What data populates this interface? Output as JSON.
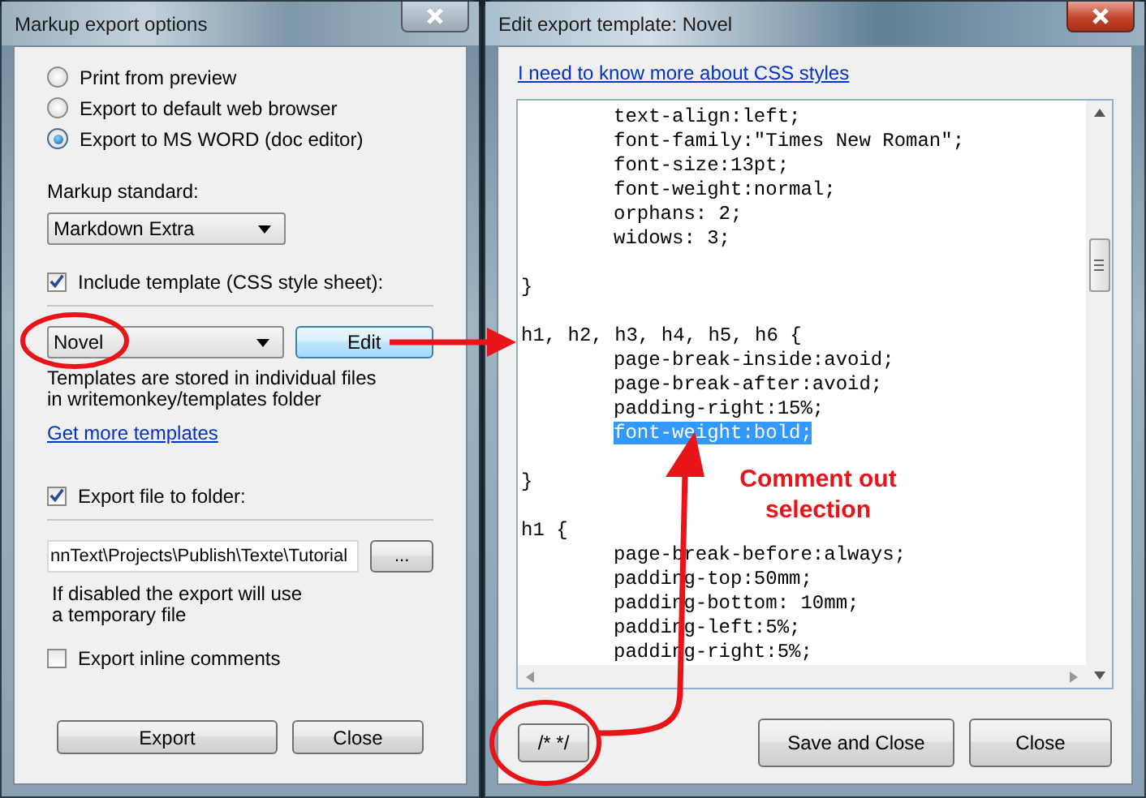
{
  "left_window": {
    "title": "Markup export options",
    "active": false,
    "output_options": [
      {
        "label": "Print from preview",
        "selected": false
      },
      {
        "label": "Export to default web browser",
        "selected": false
      },
      {
        "label": "Export to MS WORD (doc editor)",
        "selected": true
      }
    ],
    "markup_standard": {
      "label": "Markup standard:",
      "value": "Markdown Extra"
    },
    "include_template": {
      "label": "Include template (CSS style sheet):",
      "checked": true
    },
    "template": {
      "value": "Novel"
    },
    "edit_button": "Edit",
    "template_note": "Templates are stored in individual files\nin writemonkey/templates folder",
    "more_templates_link": "Get more templates",
    "export_to_folder": {
      "label": "Export file to folder:",
      "checked": true
    },
    "folder_path": "nnText\\Projects\\Publish\\Texte\\Tutorial",
    "browse_button": "...",
    "folder_note": "If disabled the export will use\na temporary file",
    "inline_comments": {
      "label": "Export inline comments",
      "checked": false
    },
    "buttons": [
      "Export",
      "Close"
    ]
  },
  "right_window": {
    "title": "Edit export template: Novel",
    "active": true,
    "css_link": "I need to know more about CSS styles",
    "code_lines": [
      {
        "kind": "indented",
        "text": "text-align:left;",
        "selected": false
      },
      {
        "kind": "indented",
        "text": "font-family:\"Times New Roman\";",
        "selected": false
      },
      {
        "kind": "indented",
        "text": "font-size:13pt;",
        "selected": false
      },
      {
        "kind": "indented",
        "text": "font-weight:normal;",
        "selected": false
      },
      {
        "kind": "indented",
        "text": "orphans: 2;",
        "selected": false
      },
      {
        "kind": "indented",
        "text": "widows: 3;",
        "selected": false
      },
      {
        "kind": "blank"
      },
      {
        "kind": "top",
        "text": "}",
        "selected": false
      },
      {
        "kind": "blank"
      },
      {
        "kind": "top",
        "text": "h1, h2, h3, h4, h5, h6 {",
        "selected": false
      },
      {
        "kind": "indented",
        "text": "page-break-inside:avoid;",
        "selected": false
      },
      {
        "kind": "indented",
        "text": "page-break-after:avoid;",
        "selected": false
      },
      {
        "kind": "indented",
        "text": "padding-right:15%;",
        "selected": false
      },
      {
        "kind": "indented",
        "text": "font-weight:bold;",
        "selected": true
      },
      {
        "kind": "blank"
      },
      {
        "kind": "top",
        "text": "}",
        "selected": false
      },
      {
        "kind": "blank"
      },
      {
        "kind": "top",
        "text": "h1 {",
        "selected": false
      },
      {
        "kind": "indented",
        "text": "page-break-before:always;",
        "selected": false
      },
      {
        "kind": "indented",
        "text": "padding-top:50mm;",
        "selected": false
      },
      {
        "kind": "indented",
        "text": "padding-bottom: 10mm;",
        "selected": false
      },
      {
        "kind": "indented",
        "text": "padding-left:5%;",
        "selected": false
      },
      {
        "kind": "indented",
        "text": "padding-right:5%;",
        "selected": false
      }
    ],
    "comment_button": "/*  */",
    "buttons": [
      "Save and Close",
      "Close"
    ]
  },
  "annotation": {
    "callout": "Comment out\nselection"
  }
}
